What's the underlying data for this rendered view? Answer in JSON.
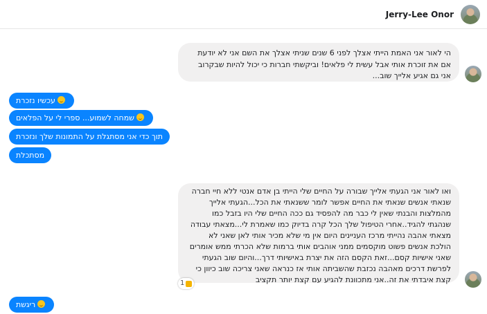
{
  "header": {
    "contact_name": "Jerry-Lee Onor"
  },
  "messages": {
    "incoming_1": "הי לאור אני האמת הייתי אצלך לפני 6 שנים שניתי אצלך את השם אני לא יודעת אם את זוכרת אותי אבל עשית לי פלאים! וביקשתי חברות כי יכול להיות שבקרוב אני גם אגיע אלייך שוב...",
    "outgoing_1": "עכשיו נזכרת",
    "outgoing_2": "שמחה לשמוע... ספרי לי על הפלאים",
    "outgoing_3": "תוך כדי אני מסתגלת על התמונות שלך ונזכרת",
    "outgoing_4": "מסתכלת",
    "incoming_2": "ואו לאור אני הגעתי אלייך שבורה על החיים שלי הייתי בן אדם אנטי ללא חיי חברה שנאתי אנשים שנאתי את החיים אפשר לומר ששנאתי את הכל...הגעתי אלייך מהמלצות והבנתי שאין לי כבר מה להפסיד גם ככה החיים שלי היו בזבל כמו שנהגתי להגיד..אחרי הטיפול שלך הכל קרה בדיוק כמו שאמרת לי...מצאתי עבודה מצאתי אהבה נהייתי מרכז העניינים היום אין מי שלא מכיר אותי לאן שאני לא הולכת אנשים פשוט מוקסמים ממני אוהבים אותי ברמות שלא הכרתי ממש אומרים שאני אישיות קסם...זאת הקסם הזה את יצרת באישיותי דרך...והיום שוב הגעתי לפרשת דרכים מאהבה נכזבת שהשביתה אותי אז כנראה שאני צריכה שוב כיוון כי קצת איבדתי את זה..אני מתכוונת להגיע עם קצת יותר תקציב",
    "outgoing_5": "ריגשת"
  },
  "reaction": {
    "count": "1",
    "icon": "thumbs-down-icon"
  },
  "colors": {
    "outgoing_bubble": "#0a84ff",
    "incoming_bubble": "#f1f0f0"
  }
}
